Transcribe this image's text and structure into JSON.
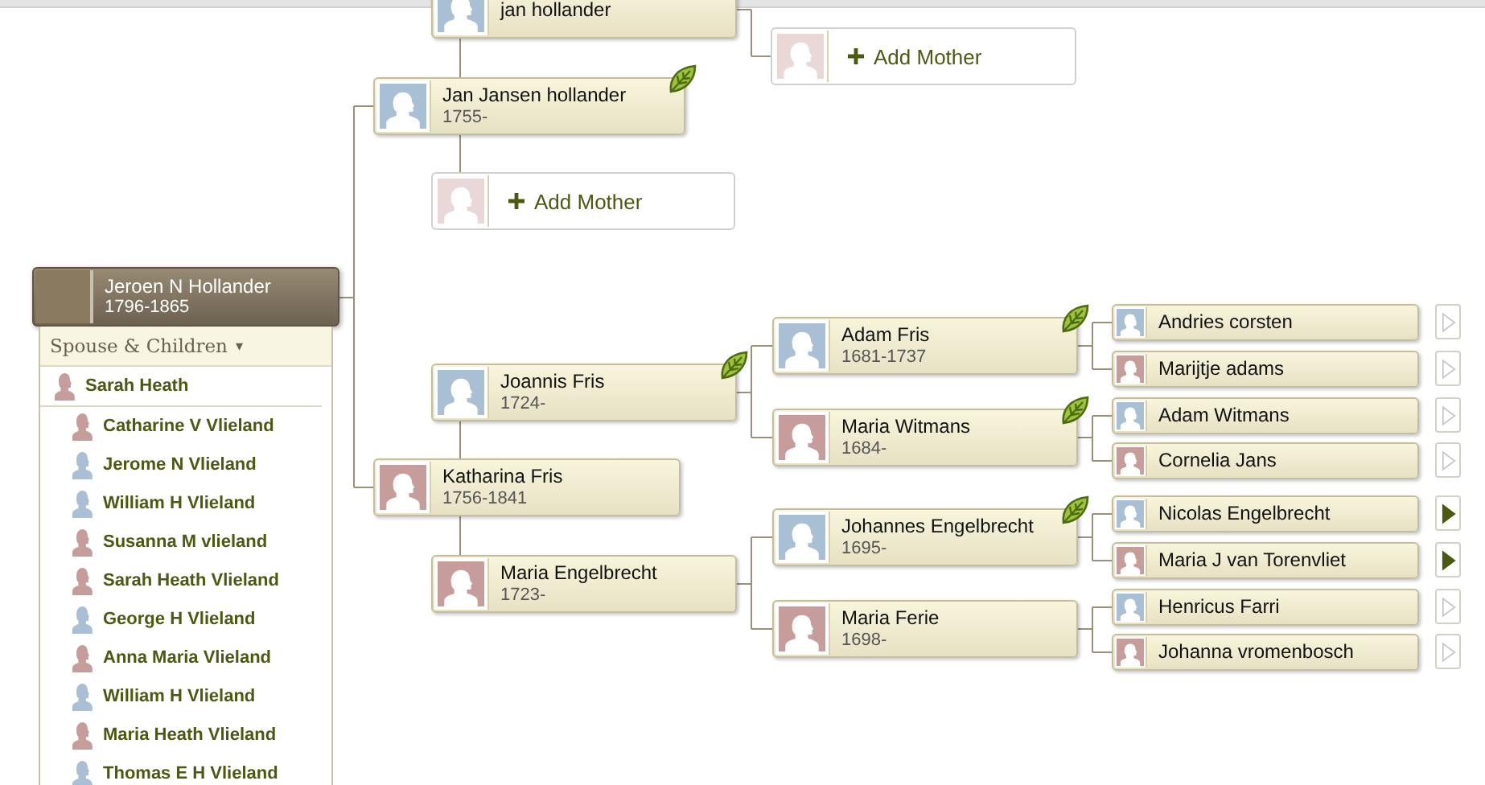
{
  "focus_person": {
    "name": "Jeroen N Hollander",
    "dates": "1796-1865",
    "spouse_and_children": {
      "header": "Spouse & Children",
      "toggle": "▾",
      "spouse": {
        "name": "Sarah Heath",
        "kind": "female"
      },
      "children": [
        {
          "name": "Catharine V Vlieland",
          "kind": "female"
        },
        {
          "name": "Jerome N Vlieland",
          "kind": "male"
        },
        {
          "name": "William H Vlieland",
          "kind": "male"
        },
        {
          "name": "Susanna M vlieland",
          "kind": "female"
        },
        {
          "name": "Sarah Heath Vlieland",
          "kind": "female"
        },
        {
          "name": "George H Vlieland",
          "kind": "male"
        },
        {
          "name": "Anna Maria Vlieland",
          "kind": "female"
        },
        {
          "name": "William H Vlieland",
          "kind": "male"
        },
        {
          "name": "Maria Heath Vlieland",
          "kind": "female"
        },
        {
          "name": "Thomas E H Vlieland",
          "kind": "male"
        }
      ]
    },
    "parents": [
      {
        "kind": "male",
        "name": "Jan Jansen hollander",
        "dates": "1755-",
        "hint": true,
        "parents": [
          {
            "kind": "male",
            "name": "jan hollander",
            "hint": false,
            "parents": [
              {
                "kind": "add",
                "label": "Add Mother"
              }
            ]
          },
          {
            "kind": "add",
            "label": "Add Mother"
          }
        ]
      },
      {
        "kind": "female",
        "name": "Katharina Fris",
        "dates": "1756-1841",
        "hint": false,
        "parents": [
          {
            "kind": "male",
            "name": "Joannis Fris",
            "dates": "1724-",
            "hint": true,
            "parents": [
              {
                "kind": "male",
                "name": "Adam Fris",
                "dates": "1681-1737",
                "hint": true,
                "parents": [
                  {
                    "kind": "male",
                    "name": "Andries corsten",
                    "expandable": false
                  },
                  {
                    "kind": "female",
                    "name": "Marijtje adams",
                    "expandable": false
                  }
                ]
              },
              {
                "kind": "female",
                "name": "Maria Witmans",
                "dates": "1684-",
                "hint": true,
                "parents": [
                  {
                    "kind": "male",
                    "name": "Adam Witmans",
                    "expandable": false
                  },
                  {
                    "kind": "female",
                    "name": "Cornelia Jans",
                    "expandable": false
                  }
                ]
              }
            ]
          },
          {
            "kind": "female",
            "name": "Maria Engelbrecht",
            "dates": "1723-",
            "hint": false,
            "parents": [
              {
                "kind": "male",
                "name": "Johannes Engelbrecht",
                "dates": "1695-",
                "hint": true,
                "parents": [
                  {
                    "kind": "male",
                    "name": "Nicolas Engelbrecht",
                    "expandable": true
                  },
                  {
                    "kind": "female",
                    "name": "Maria J van Torenvliet",
                    "expandable": true
                  }
                ]
              },
              {
                "kind": "female",
                "name": "Maria Ferie",
                "dates": "1698-",
                "hint": false,
                "parents": [
                  {
                    "kind": "male",
                    "name": "Henricus Farri",
                    "expandable": false
                  },
                  {
                    "kind": "female",
                    "name": "Johanna vromenbosch",
                    "expandable": false
                  }
                ]
              }
            ]
          }
        ]
      }
    ]
  }
}
